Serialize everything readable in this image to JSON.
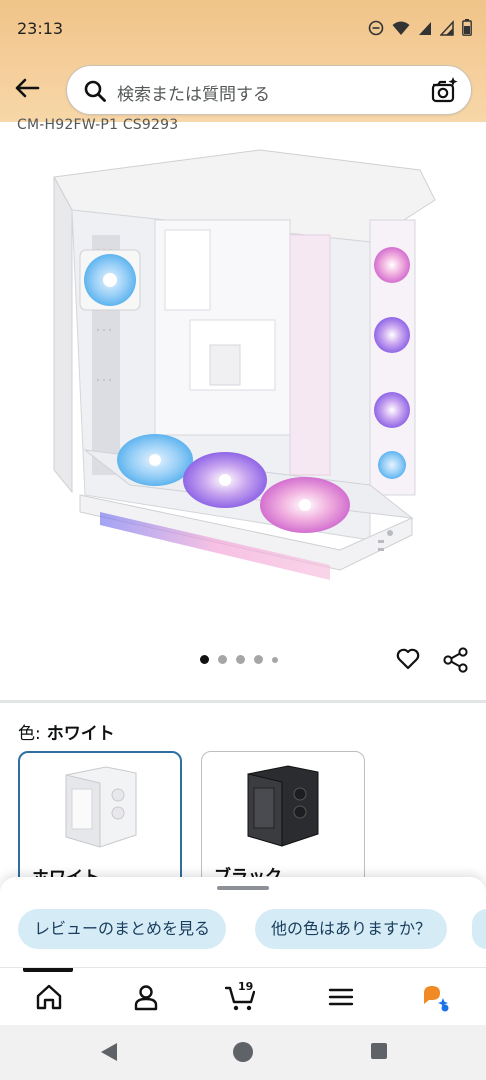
{
  "status_bar": {
    "time": "23:13"
  },
  "search": {
    "placeholder": "検索または質問する"
  },
  "product": {
    "model_code": "CM-H92FW-P1 CS9293",
    "image_count": 5,
    "active_image_index": 0
  },
  "color_selector": {
    "label": "色:",
    "selected": "ホワイト",
    "options": [
      {
        "name": "ホワイト"
      },
      {
        "name": "ブラック"
      }
    ]
  },
  "suggestions": [
    {
      "label": "レビューのまとめを見る"
    },
    {
      "label": "他の色はありますか？"
    }
  ],
  "nav": {
    "cart_count": "19",
    "items": [
      "home-icon",
      "account-icon",
      "cart-icon",
      "menu-icon",
      "rufus-icon"
    ]
  },
  "colors": {
    "header": "#f3c993",
    "chip_bg": "#d5ecf7",
    "selected_border": "#2f6f9f",
    "rufus": "#f08a24"
  }
}
